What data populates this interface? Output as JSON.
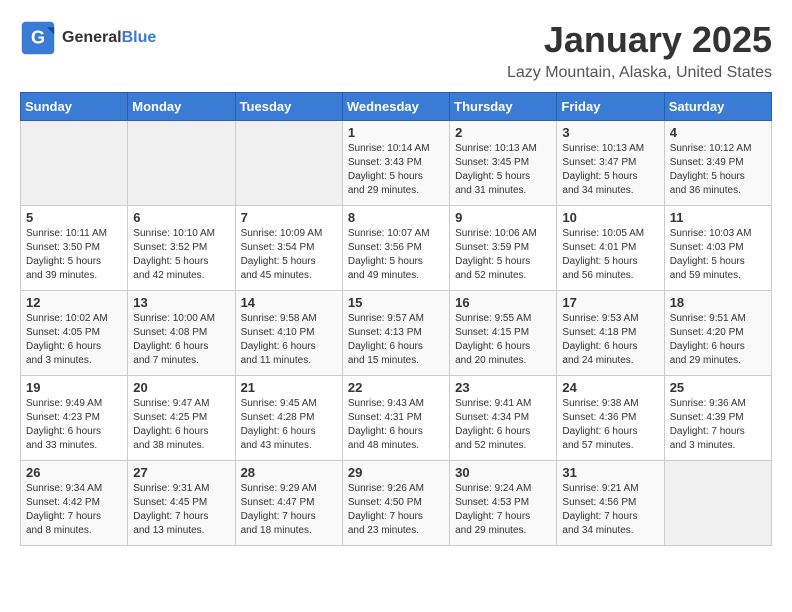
{
  "logo": {
    "general": "General",
    "blue": "Blue"
  },
  "title": "January 2025",
  "subtitle": "Lazy Mountain, Alaska, United States",
  "header_days": [
    "Sunday",
    "Monday",
    "Tuesday",
    "Wednesday",
    "Thursday",
    "Friday",
    "Saturday"
  ],
  "weeks": [
    [
      {
        "day": "",
        "info": ""
      },
      {
        "day": "",
        "info": ""
      },
      {
        "day": "",
        "info": ""
      },
      {
        "day": "1",
        "info": "Sunrise: 10:14 AM\nSunset: 3:43 PM\nDaylight: 5 hours\nand 29 minutes."
      },
      {
        "day": "2",
        "info": "Sunrise: 10:13 AM\nSunset: 3:45 PM\nDaylight: 5 hours\nand 31 minutes."
      },
      {
        "day": "3",
        "info": "Sunrise: 10:13 AM\nSunset: 3:47 PM\nDaylight: 5 hours\nand 34 minutes."
      },
      {
        "day": "4",
        "info": "Sunrise: 10:12 AM\nSunset: 3:49 PM\nDaylight: 5 hours\nand 36 minutes."
      }
    ],
    [
      {
        "day": "5",
        "info": "Sunrise: 10:11 AM\nSunset: 3:50 PM\nDaylight: 5 hours\nand 39 minutes."
      },
      {
        "day": "6",
        "info": "Sunrise: 10:10 AM\nSunset: 3:52 PM\nDaylight: 5 hours\nand 42 minutes."
      },
      {
        "day": "7",
        "info": "Sunrise: 10:09 AM\nSunset: 3:54 PM\nDaylight: 5 hours\nand 45 minutes."
      },
      {
        "day": "8",
        "info": "Sunrise: 10:07 AM\nSunset: 3:56 PM\nDaylight: 5 hours\nand 49 minutes."
      },
      {
        "day": "9",
        "info": "Sunrise: 10:06 AM\nSunset: 3:59 PM\nDaylight: 5 hours\nand 52 minutes."
      },
      {
        "day": "10",
        "info": "Sunrise: 10:05 AM\nSunset: 4:01 PM\nDaylight: 5 hours\nand 56 minutes."
      },
      {
        "day": "11",
        "info": "Sunrise: 10:03 AM\nSunset: 4:03 PM\nDaylight: 5 hours\nand 59 minutes."
      }
    ],
    [
      {
        "day": "12",
        "info": "Sunrise: 10:02 AM\nSunset: 4:05 PM\nDaylight: 6 hours\nand 3 minutes."
      },
      {
        "day": "13",
        "info": "Sunrise: 10:00 AM\nSunset: 4:08 PM\nDaylight: 6 hours\nand 7 minutes."
      },
      {
        "day": "14",
        "info": "Sunrise: 9:58 AM\nSunset: 4:10 PM\nDaylight: 6 hours\nand 11 minutes."
      },
      {
        "day": "15",
        "info": "Sunrise: 9:57 AM\nSunset: 4:13 PM\nDaylight: 6 hours\nand 15 minutes."
      },
      {
        "day": "16",
        "info": "Sunrise: 9:55 AM\nSunset: 4:15 PM\nDaylight: 6 hours\nand 20 minutes."
      },
      {
        "day": "17",
        "info": "Sunrise: 9:53 AM\nSunset: 4:18 PM\nDaylight: 6 hours\nand 24 minutes."
      },
      {
        "day": "18",
        "info": "Sunrise: 9:51 AM\nSunset: 4:20 PM\nDaylight: 6 hours\nand 29 minutes."
      }
    ],
    [
      {
        "day": "19",
        "info": "Sunrise: 9:49 AM\nSunset: 4:23 PM\nDaylight: 6 hours\nand 33 minutes."
      },
      {
        "day": "20",
        "info": "Sunrise: 9:47 AM\nSunset: 4:25 PM\nDaylight: 6 hours\nand 38 minutes."
      },
      {
        "day": "21",
        "info": "Sunrise: 9:45 AM\nSunset: 4:28 PM\nDaylight: 6 hours\nand 43 minutes."
      },
      {
        "day": "22",
        "info": "Sunrise: 9:43 AM\nSunset: 4:31 PM\nDaylight: 6 hours\nand 48 minutes."
      },
      {
        "day": "23",
        "info": "Sunrise: 9:41 AM\nSunset: 4:34 PM\nDaylight: 6 hours\nand 52 minutes."
      },
      {
        "day": "24",
        "info": "Sunrise: 9:38 AM\nSunset: 4:36 PM\nDaylight: 6 hours\nand 57 minutes."
      },
      {
        "day": "25",
        "info": "Sunrise: 9:36 AM\nSunset: 4:39 PM\nDaylight: 7 hours\nand 3 minutes."
      }
    ],
    [
      {
        "day": "26",
        "info": "Sunrise: 9:34 AM\nSunset: 4:42 PM\nDaylight: 7 hours\nand 8 minutes."
      },
      {
        "day": "27",
        "info": "Sunrise: 9:31 AM\nSunset: 4:45 PM\nDaylight: 7 hours\nand 13 minutes."
      },
      {
        "day": "28",
        "info": "Sunrise: 9:29 AM\nSunset: 4:47 PM\nDaylight: 7 hours\nand 18 minutes."
      },
      {
        "day": "29",
        "info": "Sunrise: 9:26 AM\nSunset: 4:50 PM\nDaylight: 7 hours\nand 23 minutes."
      },
      {
        "day": "30",
        "info": "Sunrise: 9:24 AM\nSunset: 4:53 PM\nDaylight: 7 hours\nand 29 minutes."
      },
      {
        "day": "31",
        "info": "Sunrise: 9:21 AM\nSunset: 4:56 PM\nDaylight: 7 hours\nand 34 minutes."
      },
      {
        "day": "",
        "info": ""
      }
    ]
  ]
}
